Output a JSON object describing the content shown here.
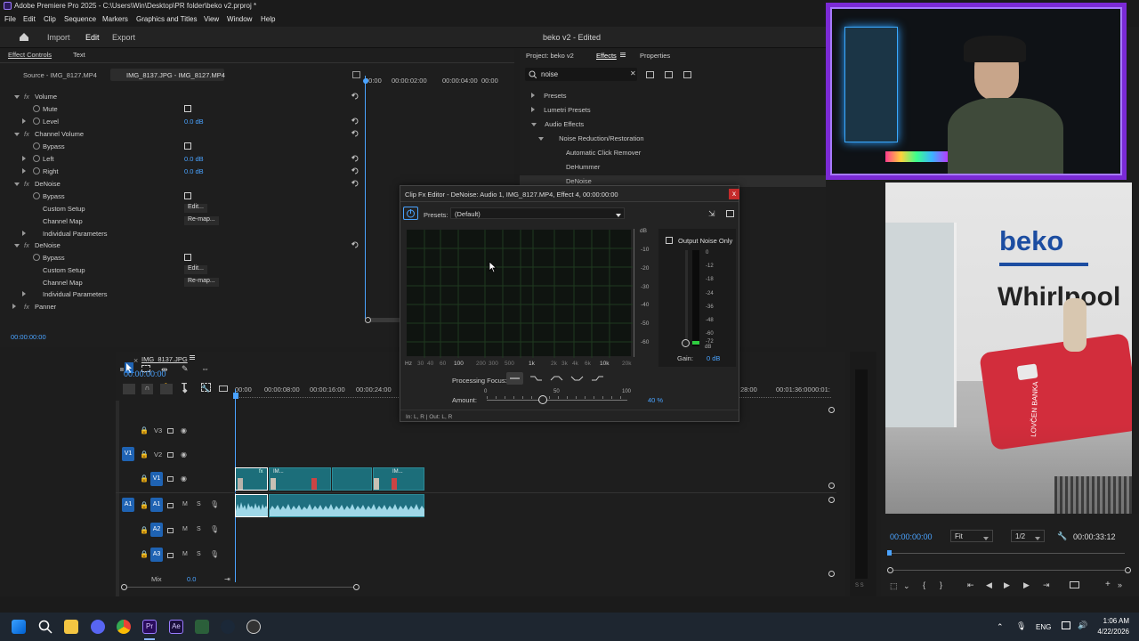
{
  "app": {
    "title": "Adobe Premiere Pro 2025 - C:\\Users\\Win\\Desktop\\PR folder\\beko v2.prproj *",
    "menu": [
      "File",
      "Edit",
      "Clip",
      "Sequence",
      "Markers",
      "Graphics and Titles",
      "View",
      "Window",
      "Help"
    ]
  },
  "header": {
    "import": "Import",
    "edit": "Edit",
    "export": "Export",
    "project_title": "beko v2",
    "status": "- Edited"
  },
  "effect_controls": {
    "tab_label": "Effect Controls",
    "tab_text": "Text",
    "source_label": "Source - IMG_8127.MP4",
    "clip_label": "IMG_8137.JPG - IMG_8127.MP4",
    "ruler": [
      "00:00",
      "00:00:02:00",
      "00:00:04:00",
      "00:00"
    ],
    "rows": {
      "volume": "Volume",
      "mute": "Mute",
      "level": "Level",
      "level_val": "0.0 dB",
      "channel_volume": "Channel Volume",
      "bypass1": "Bypass",
      "left": "Left",
      "left_val": "0.0 dB",
      "right": "Right",
      "right_val": "0.0 dB",
      "denoise1": "DeNoise",
      "bypass2": "Bypass",
      "custom_setup1": "Custom Setup",
      "edit1": "Edit...",
      "channel_map1": "Channel Map",
      "remap1": "Re-map...",
      "individual1": "Individual Parameters",
      "denoise2": "DeNoise",
      "bypass3": "Bypass",
      "custom_setup2": "Custom Setup",
      "edit2": "Edit...",
      "channel_map2": "Channel Map",
      "remap2": "Re-map...",
      "individual2": "Individual Parameters",
      "panner": "Panner"
    },
    "timecode": "00:00:00:00"
  },
  "project": {
    "tab_project": "Project: beko v2",
    "tab_effects": "Effects",
    "tab_properties": "Properties",
    "search_value": "noise",
    "tree": [
      "Presets",
      "Lumetri Presets",
      "Audio Effects",
      "Noise Reduction/Restoration",
      "Automatic Click Remover",
      "DeHummer",
      "DeNoise"
    ]
  },
  "dialog": {
    "title": "Clip Fx Editor - DeNoise: Audio 1, IMG_8127.MP4, Effect 4, 00:00:00:00",
    "close": "x",
    "presets_label": "Presets:",
    "presets_value": "(Default)",
    "db_label": "dB",
    "db_ticks": [
      "-10",
      "-20",
      "-30",
      "-40",
      "-50",
      "-60"
    ],
    "hz_label": "Hz",
    "hz_ticks": [
      "30",
      "40",
      "60",
      "100",
      "200",
      "300",
      "500",
      "1k",
      "2k",
      "3k",
      "4k",
      "6k",
      "10k",
      "20k"
    ],
    "output_noise_only": "Output Noise Only",
    "meter_ticks": [
      "0",
      "-12",
      "-18",
      "-24",
      "-36",
      "-48",
      "-60",
      "-72"
    ],
    "meter_db": "dB",
    "gain_label": "Gain:",
    "gain_value": "0 dB",
    "processing_focus": "Processing Focus:",
    "amount_label": "Amount:",
    "amount_ticks": [
      "0",
      "50",
      "100"
    ],
    "amount_value": "40 %",
    "amount_fraction": 0.4,
    "footer": "In: L, R | Out: L, R"
  },
  "timeline": {
    "sequence_name": "IMG_8137.JPG",
    "timecode": "00:00:00:00",
    "ruler": [
      "00:00",
      "00:00:08:00",
      "00:00:16:00",
      "00:00:24:00",
      "28:00",
      "00:01:36:00",
      "00:01:"
    ],
    "tracks": {
      "v3": "V3",
      "v2": "V2",
      "v1": "V1",
      "v1_src": "V1",
      "a1": "A1",
      "a1_src": "A1",
      "a2": "A2",
      "a3": "A3",
      "m": "M",
      "s": "S",
      "mix": "Mix",
      "mix_val": "0.0"
    },
    "clip_labels": [
      "fx",
      "IM...",
      "IM..."
    ]
  },
  "program": {
    "timecode": "00:00:00:00",
    "fit": "Fit",
    "res": "1/2",
    "duration": "00:00:33:12",
    "sign_text_1": "beko",
    "sign_text_2": "Whirlpool",
    "card_text": "LOVČEN BANKA"
  },
  "taskbar": {
    "lang": "ENG",
    "time": "1:06 AM",
    "date": "4/22/2026"
  },
  "colors": {
    "accent": "#4aa3ff",
    "timeline_clip": "#1c6e7a",
    "track_button": "#1f63b3",
    "stream_frame": "#7b2ad6"
  }
}
